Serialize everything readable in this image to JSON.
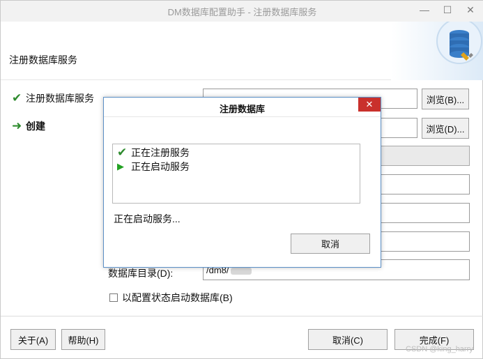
{
  "window": {
    "title": "DM数据库配置助手 - 注册数据库服务",
    "controls": {
      "minimize": "—",
      "maximize": "☐",
      "close": "✕"
    }
  },
  "header": {
    "title": "注册数据库服务"
  },
  "steps": [
    {
      "icon": "checkmark-icon",
      "label": "注册数据库服务",
      "icon_color": "#2e8b2e"
    },
    {
      "icon": "arrow-right-icon",
      "label": "创建",
      "icon_color": "#2e8b2e"
    }
  ],
  "form": {
    "browse_b_label": "浏览(B)...",
    "browse_d_label": "浏览(D)...",
    "db_dir_label": "数据库目录(D):",
    "db_dir_value": "/dm8/",
    "config_start_label": "以配置状态启动数据库(B)"
  },
  "dialog": {
    "title": "注册数据库",
    "close": "✕",
    "items": [
      {
        "icon": "checkmark-icon",
        "label": "正在注册服务",
        "color": "#2e8b2e"
      },
      {
        "icon": "play-icon",
        "label": "正在启动服务",
        "color": "#22a122"
      }
    ],
    "status": "正在启动服务...",
    "cancel_label": "取消"
  },
  "footer": {
    "about_label": "关于(A)",
    "help_label": "帮助(H)",
    "cancel_label": "取消(C)",
    "finish_label": "完成(F)"
  },
  "watermark": "CSDN @king_harry",
  "colors": {
    "accent_blue": "#3a7fc9",
    "close_red": "#c9302c",
    "ok_green": "#2e8b2e"
  }
}
